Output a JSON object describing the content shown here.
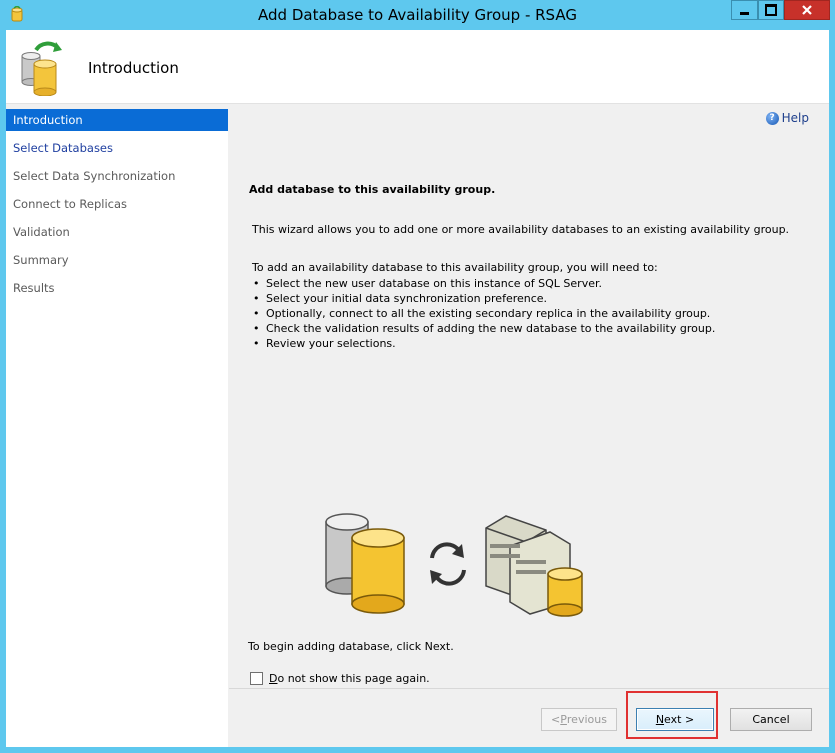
{
  "window": {
    "title": "Add Database to Availability Group - RSAG",
    "icons": {
      "app": "sql-wizard-icon",
      "minimize": "minimize-icon",
      "maximize": "maximize-icon",
      "close": "close-icon"
    },
    "close_color": "#c7312a"
  },
  "header": {
    "title": "Introduction",
    "icon": "database-sync-icon"
  },
  "sidebar": {
    "items": [
      {
        "label": "Introduction",
        "state": "active"
      },
      {
        "label": "Select Databases",
        "state": "link"
      },
      {
        "label": "Select Data Synchronization",
        "state": "disabled"
      },
      {
        "label": "Connect to Replicas",
        "state": "disabled"
      },
      {
        "label": "Validation",
        "state": "disabled"
      },
      {
        "label": "Summary",
        "state": "disabled"
      },
      {
        "label": "Results",
        "state": "disabled"
      }
    ],
    "active_color": "#0a6cd6"
  },
  "main": {
    "help_label": "Help",
    "heading": "Add database to this availability group.",
    "intro": "This wizard allows you to add one or more availability databases to an existing availability group.",
    "steps_intro": "To add an availability database to this availability group, you will need to:",
    "steps": [
      "Select the new user database on this instance of SQL Server.",
      "Select your initial data synchronization preference.",
      "Optionally, connect to all the existing secondary replica in the availability group.",
      "Check the validation results of adding the new database to the availability group.",
      "Review your selections."
    ],
    "begin_text": "To begin adding database, click Next.",
    "checkbox": {
      "mnemonic": "D",
      "rest": "o not show this page again.",
      "checked": false
    }
  },
  "footer": {
    "previous": {
      "prefix": "< ",
      "mnemonic": "P",
      "rest": "revious",
      "enabled": false
    },
    "next": {
      "mnemonic": "N",
      "rest": "ext >"
    },
    "cancel": "Cancel",
    "highlight_color": "#e03131"
  }
}
